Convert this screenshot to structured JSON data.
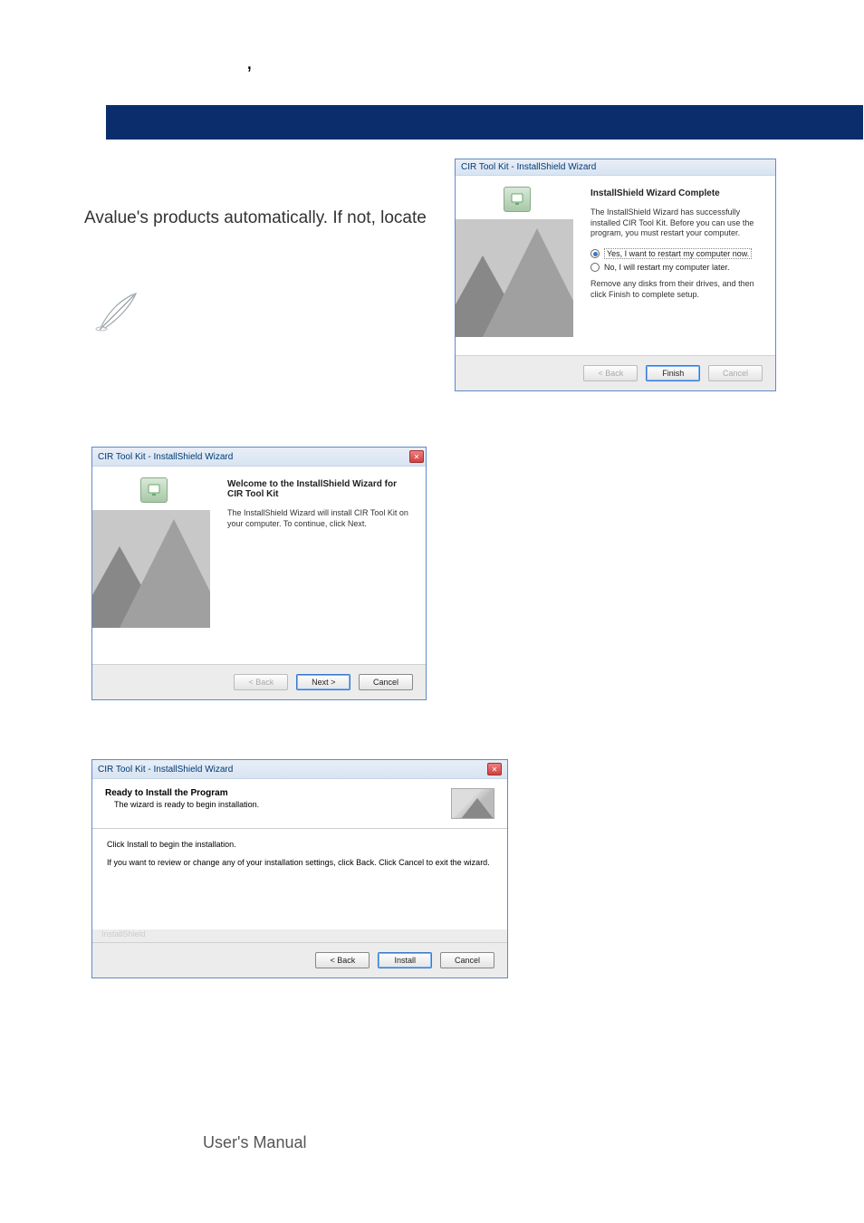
{
  "top_quote": ",",
  "left_text": "Avalue's products automatically. If not, locate",
  "d1": {
    "title": "CIR Tool Kit - InstallShield Wizard",
    "heading": "InstallShield Wizard Complete",
    "p1": "The InstallShield Wizard has successfully installed CIR Tool Kit. Before you can use the program, you must restart your computer.",
    "radio1": "Yes, I want to restart my computer now.",
    "radio2": "No, I will restart my computer later.",
    "p2": "Remove any disks from their drives, and then click Finish to complete setup.",
    "back": "< Back",
    "finish": "Finish",
    "cancel": "Cancel"
  },
  "d2": {
    "title": "CIR Tool Kit - InstallShield Wizard",
    "heading": "Welcome to the InstallShield Wizard for CIR Tool Kit",
    "p1": "The InstallShield Wizard will install CIR Tool Kit on your computer.  To continue, click Next.",
    "back": "< Back",
    "next": "Next >",
    "cancel": "Cancel"
  },
  "d3": {
    "title": "CIR Tool Kit - InstallShield Wizard",
    "heading": "Ready to Install the Program",
    "sub": "The wizard is ready to begin installation.",
    "p1": "Click Install to begin the installation.",
    "p2": "If you want to review or change any of your installation settings, click Back. Click Cancel to exit the wizard.",
    "ishield": "InstallShield",
    "back": "< Back",
    "install": "Install",
    "cancel": "Cancel"
  },
  "footer": "User's Manual"
}
